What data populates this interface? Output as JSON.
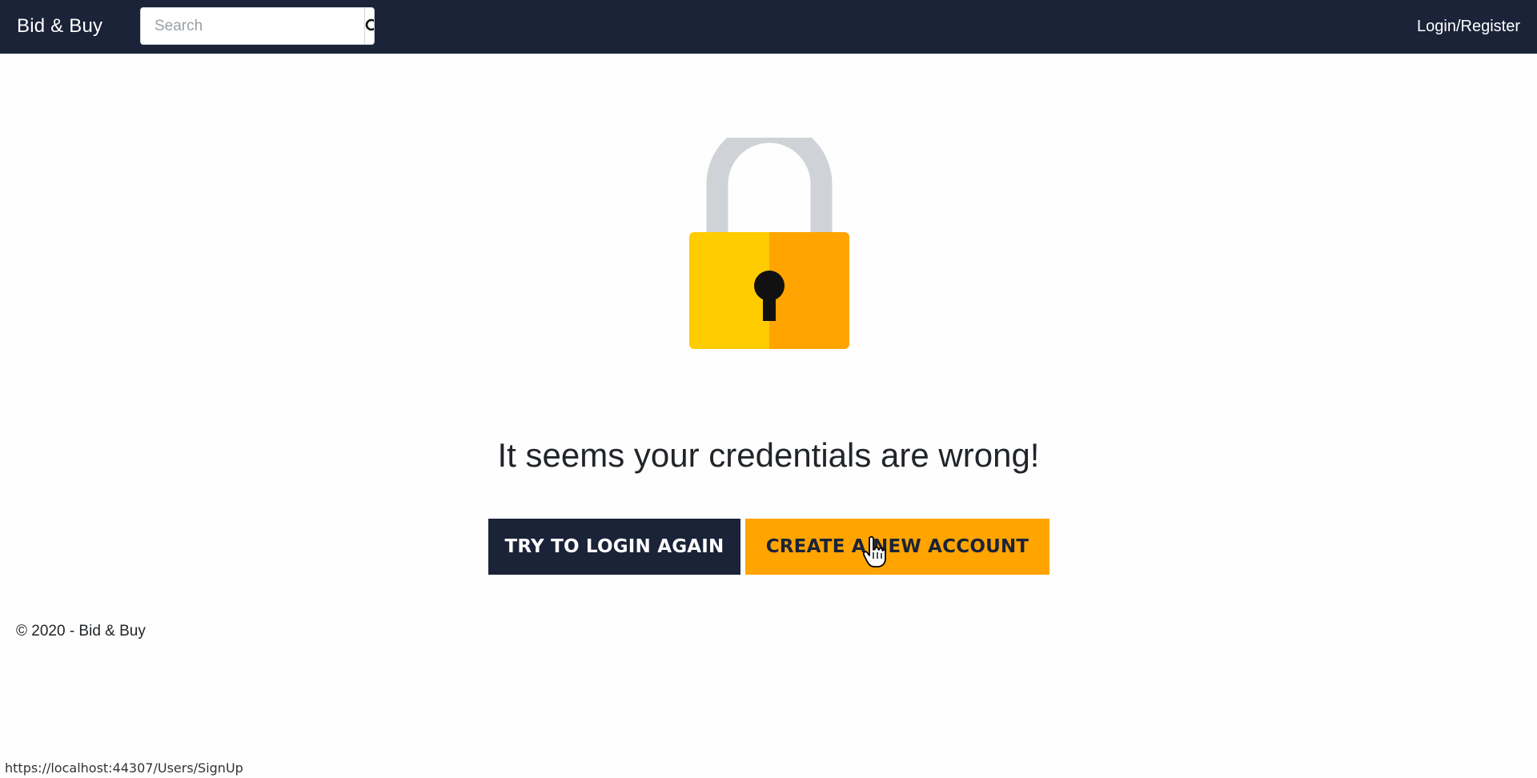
{
  "navbar": {
    "brand": "Bid & Buy",
    "search_placeholder": "Search",
    "search_icon": "search-icon",
    "login_label": "Login/Register",
    "background_color": "#1a2338"
  },
  "main": {
    "lock_icon": "padlock-icon",
    "message": "It seems your credentials are wrong!",
    "try_again_label": "TRY TO LOGIN AGAIN",
    "create_account_label": "CREATE A NEW ACCOUNT",
    "accent_color": "#ffa400"
  },
  "footer": {
    "copyright": "© 2020 - Bid & Buy"
  },
  "status_bar": {
    "url": "https://localhost:44307/Users/SignUp"
  }
}
